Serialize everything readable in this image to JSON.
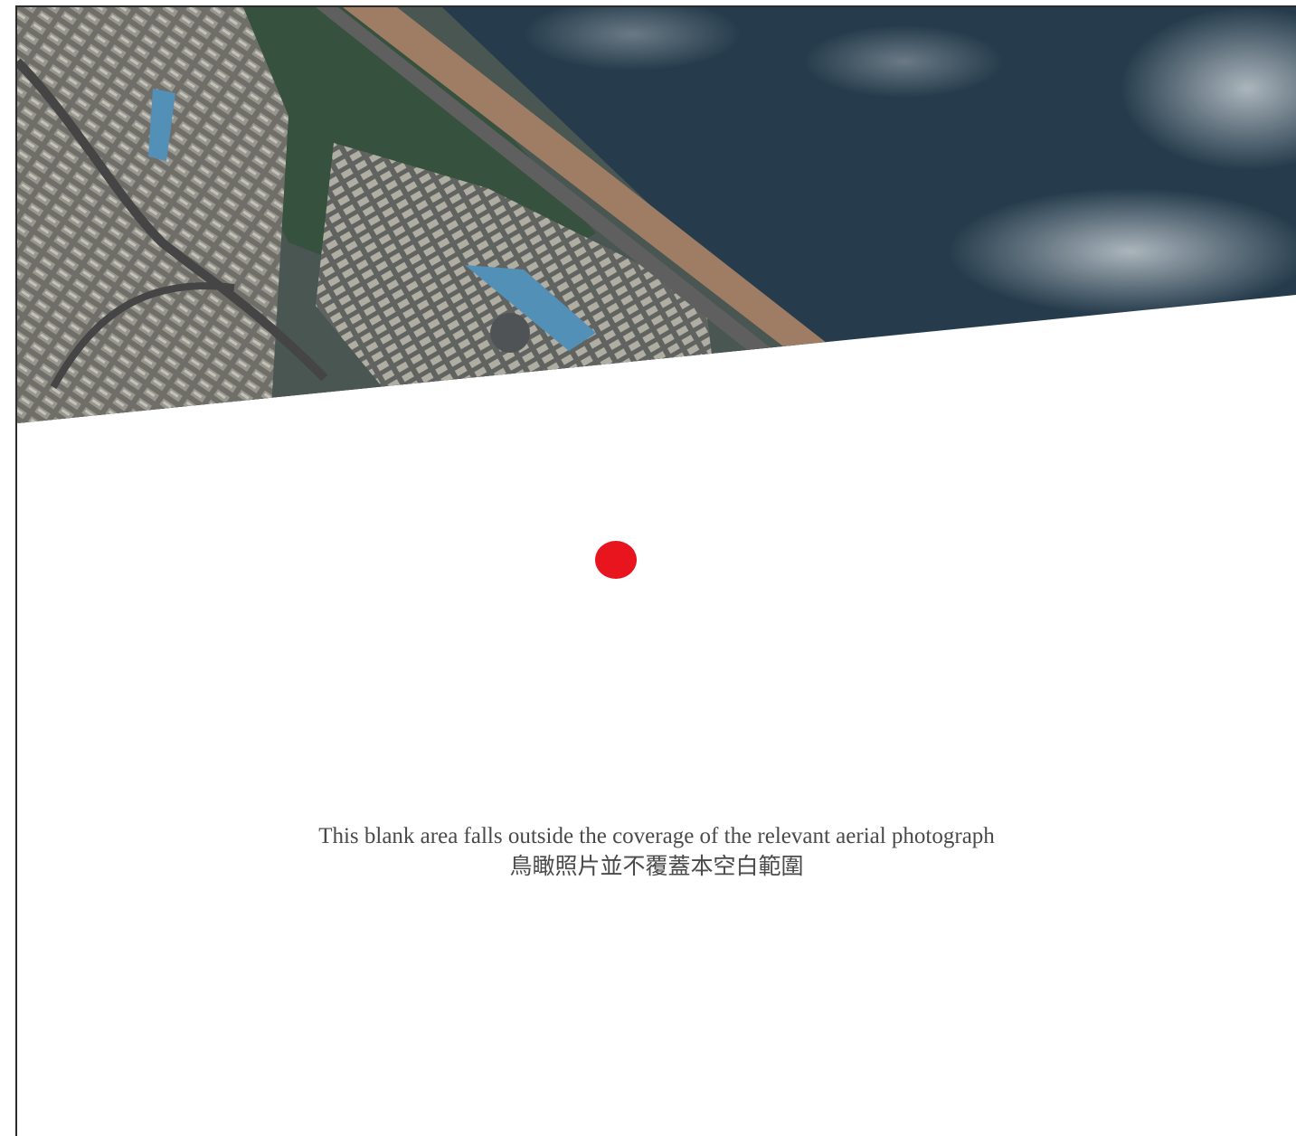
{
  "map": {
    "marker_color": "#e8141e",
    "notice": {
      "english": "This blank area falls outside the coverage of the relevant aerial photograph",
      "chinese": "鳥瞰照片並不覆蓋本空白範圍"
    }
  }
}
